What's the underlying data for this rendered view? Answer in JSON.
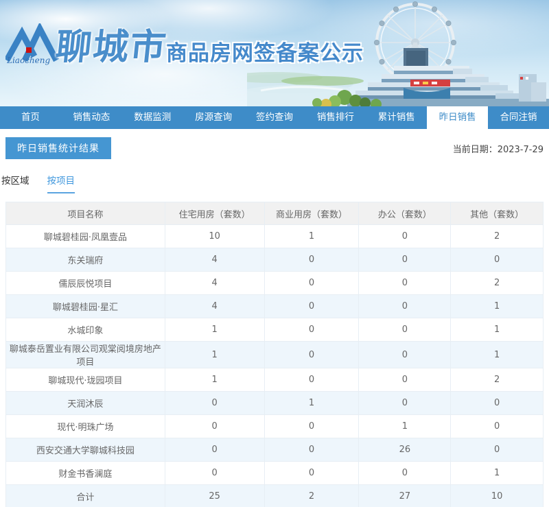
{
  "brand": {
    "logo_script": "Liaocheng",
    "city_name": "聊城市",
    "site_title": "商品房网签备案公示"
  },
  "nav": {
    "items": [
      {
        "key": "home",
        "label": "首页",
        "active": false
      },
      {
        "key": "sales-activity",
        "label": "销售动态",
        "active": false
      },
      {
        "key": "data-monitor",
        "label": "数据监测",
        "active": false
      },
      {
        "key": "listing-query",
        "label": "房源查询",
        "active": false
      },
      {
        "key": "signing-query",
        "label": "签约查询",
        "active": false
      },
      {
        "key": "sales-ranking",
        "label": "销售排行",
        "active": false
      },
      {
        "key": "cumulative-sales",
        "label": "累计销售",
        "active": false
      },
      {
        "key": "yesterday-sales",
        "label": "昨日销售",
        "active": true
      },
      {
        "key": "contract-cancel",
        "label": "合同注销",
        "active": false
      }
    ]
  },
  "main": {
    "section_title": "昨日销售统计结果",
    "date_label": "当前日期：",
    "date_value": "2023-7-29",
    "tabs": [
      {
        "key": "by-region",
        "label": "按区域",
        "active": false
      },
      {
        "key": "by-project",
        "label": "按项目",
        "active": true
      }
    ]
  },
  "table": {
    "columns": [
      "项目名称",
      "住宅用房（套数）",
      "商业用房（套数）",
      "办公（套数）",
      "其他（套数）"
    ],
    "rows": [
      [
        "聊城碧桂园·凤凰壹品",
        "10",
        "1",
        "0",
        "2"
      ],
      [
        "东关瑞府",
        "4",
        "0",
        "0",
        "0"
      ],
      [
        "儒辰辰悦项目",
        "4",
        "0",
        "0",
        "2"
      ],
      [
        "聊城碧桂园·星汇",
        "4",
        "0",
        "0",
        "1"
      ],
      [
        "水城印象",
        "1",
        "0",
        "0",
        "1"
      ],
      [
        "聊城泰岳置业有限公司观棠阅境房地产项目",
        "1",
        "0",
        "0",
        "1"
      ],
      [
        "聊城现代·珑园项目",
        "1",
        "0",
        "0",
        "2"
      ],
      [
        "天润沐辰",
        "0",
        "1",
        "0",
        "0"
      ],
      [
        "现代·明珠广场",
        "0",
        "0",
        "1",
        "0"
      ],
      [
        "西安交通大学聊城科技园",
        "0",
        "0",
        "26",
        "0"
      ],
      [
        "财金书香澜庭",
        "0",
        "0",
        "0",
        "1"
      ]
    ],
    "total_row": [
      "合计",
      "25",
      "2",
      "27",
      "10"
    ]
  },
  "colors": {
    "nav_blue": "#3e8cc8",
    "badge_blue": "#4596d2",
    "tab_active_blue": "#3f97dd",
    "logo_blue": "#3a82c4",
    "logo_red": "#cc1111",
    "row_alt_blue": "#eef6fc",
    "table_header_bg": "#f1f1f1"
  },
  "icons": {
    "logo": "liaocheng-m-logo",
    "scenery": "ferris-wheel-building-illustration"
  }
}
